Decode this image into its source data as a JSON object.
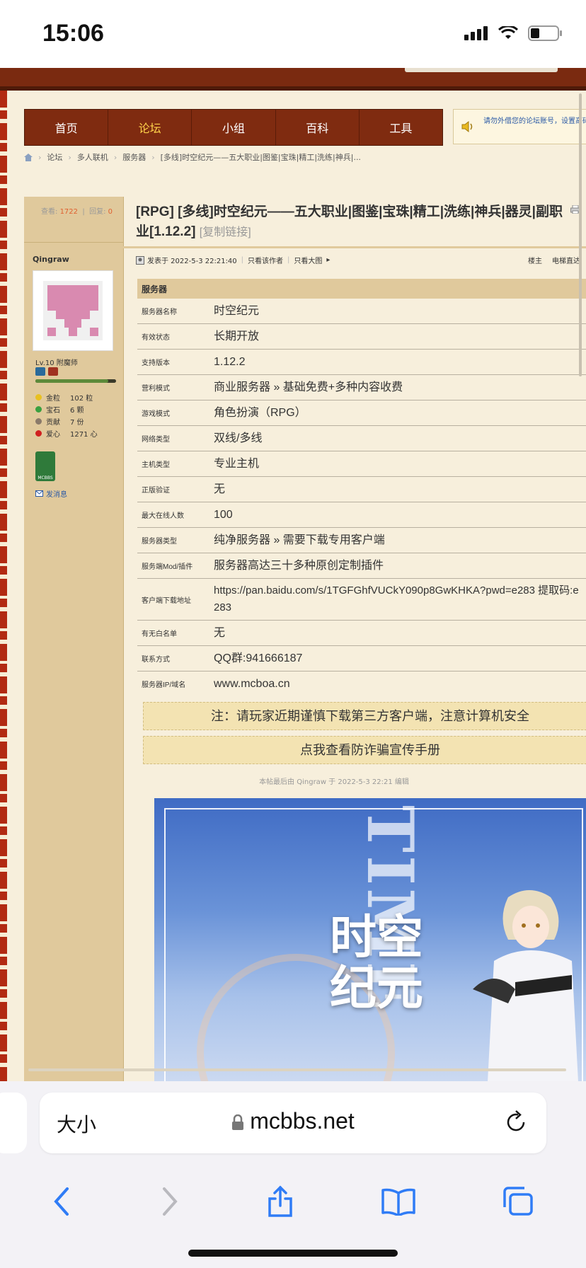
{
  "status_bar": {
    "time": "15:06"
  },
  "nav": {
    "items": [
      "首页",
      "论坛",
      "小组",
      "百科",
      "工具"
    ],
    "active_index": 1
  },
  "notice": {
    "text": "请勿外借您的论坛账号，设置高码"
  },
  "breadcrumb": [
    "论坛",
    "多人联机",
    "服务器",
    "[多线]时空纪元——五大职业|图鉴|宝珠|精工|洗练|神兵|..."
  ],
  "thread": {
    "views_label": "查看:",
    "views": "1722",
    "replies_label": "回复:",
    "replies": "0",
    "title": "[RPG] [多线]时空纪元——五大职业|图鉴|宝珠|精工|洗练|神兵|器灵|副职业[1.12.2]",
    "copy_link": "[复制链接]"
  },
  "post_meta": {
    "posted": "发表于 2022-5-3 22:21:40",
    "only_author": "只看该作者",
    "only_big_image": "只看大图",
    "floor": "楼主",
    "elevator": "电梯直达"
  },
  "author": {
    "name": "Qingraw",
    "level": "Lv.10 附魔师",
    "exp_fraction": 0.9,
    "attrs": [
      {
        "key": "金粒",
        "value": "102 粒",
        "color": "#e8c020"
      },
      {
        "key": "宝石",
        "value": "6 颗",
        "color": "#3aa040"
      },
      {
        "key": "贡献",
        "value": "7 份",
        "color": "#8a7a6a"
      },
      {
        "key": "爱心",
        "value": "1271 心",
        "color": "#d02020"
      }
    ],
    "badge_label": "MCBBS",
    "send_message": "发消息"
  },
  "server_table": {
    "header": "服务器",
    "rows": [
      {
        "key": "服务器名称",
        "value": "时空纪元"
      },
      {
        "key": "有效状态",
        "value": "长期开放"
      },
      {
        "key": "支持版本",
        "value": "1.12.2"
      },
      {
        "key": "营利模式",
        "value": "商业服务器 » 基础免费+多种内容收费"
      },
      {
        "key": "游戏模式",
        "value": "角色扮演（RPG）"
      },
      {
        "key": "网络类型",
        "value": "双线/多线"
      },
      {
        "key": "主机类型",
        "value": "专业主机"
      },
      {
        "key": "正版验证",
        "value": "无"
      },
      {
        "key": "最大在线人数",
        "value": "100"
      },
      {
        "key": "服务器类型",
        "value": "纯净服务器 » 需要下载专用客户端"
      },
      {
        "key": "服务端Mod/插件",
        "value": "服务器高达三十多种原创定制插件"
      },
      {
        "key": "客户端下载地址",
        "value": "https://pan.baidu.com/s/1TGFGhfVUCkY090p8GwKHKA?pwd=e283 提取码:e283"
      },
      {
        "key": "有无白名单",
        "value": "无"
      },
      {
        "key": "联系方式",
        "value": "QQ群:941666187"
      },
      {
        "key": "服务器IP/域名",
        "value": "www.mcboa.cn"
      }
    ]
  },
  "warning": "注：请玩家近期谨慎下载第三方客户端，注意计算机安全",
  "anti_fraud": "点我查看防诈骗宣传手册",
  "edited_note": "本帖最后由 Qingraw 于 2022-5-3 22:21 编辑",
  "banner": {
    "logo_line1": "时空",
    "logo_line2": "纪元",
    "bg_text": "TIME"
  },
  "browser": {
    "text_size": "大小",
    "domain": "mcbbs.net"
  }
}
